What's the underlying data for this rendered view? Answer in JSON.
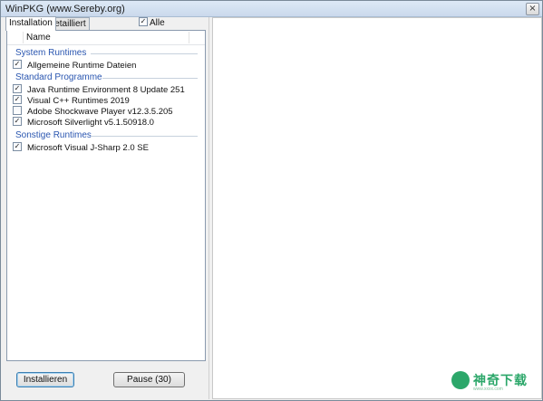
{
  "window": {
    "title": "WinPKG (www.Sereby.org)",
    "close_glyph": "×"
  },
  "tabs": [
    {
      "label": "Installation",
      "active": true
    },
    {
      "label": "Detailliert",
      "active": false
    }
  ],
  "alle": {
    "label": "Alle",
    "checked": true
  },
  "list": {
    "column_header": "Name",
    "groups": [
      {
        "name": "System Runtimes",
        "items": [
          {
            "label": "Allgemeine Runtime Dateien",
            "checked": true
          }
        ]
      },
      {
        "name": "Standard Programme",
        "items": [
          {
            "label": "Java Runtime Environment 8 Update 251",
            "checked": true
          },
          {
            "label": "Visual C++ Runtimes 2019",
            "checked": true
          },
          {
            "label": "Adobe Shockwave Player v12.3.5.205",
            "checked": false
          },
          {
            "label": "Microsoft Silverlight v5.1.50918.0",
            "checked": true
          }
        ]
      },
      {
        "name": "Sonstige Runtimes",
        "items": [
          {
            "label": "Microsoft Visual J-Sharp 2.0 SE",
            "checked": true
          }
        ]
      }
    ]
  },
  "buttons": {
    "install_label": "Installieren",
    "pause_label": "Pause (30)"
  },
  "watermark": {
    "text": "神奇下载",
    "sub": "www.xxxx.com"
  },
  "colors": {
    "group_text": "#2a56b0",
    "watermark": "#2ca76a"
  }
}
